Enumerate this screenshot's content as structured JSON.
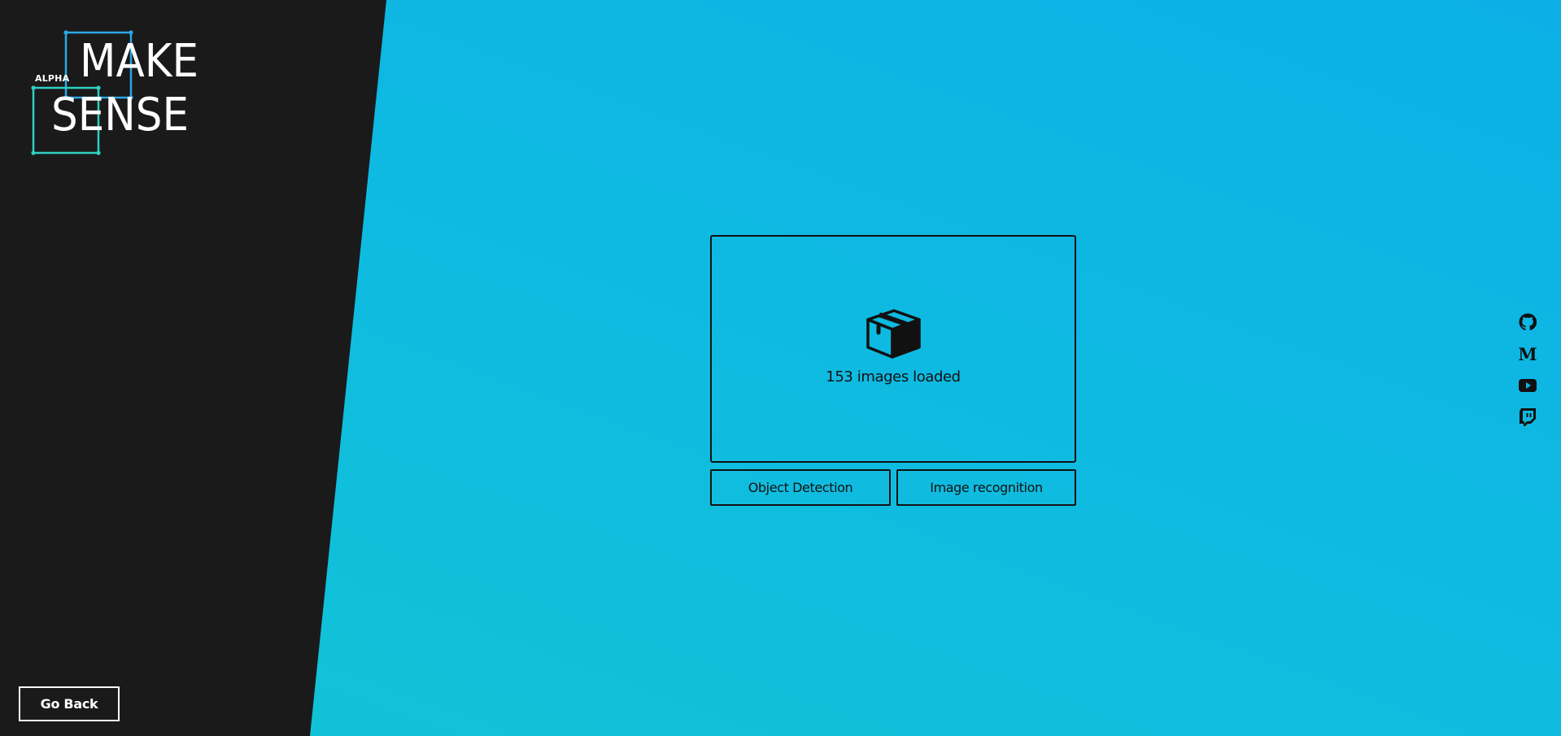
{
  "app": {
    "brand_top": "MAKE",
    "brand_bottom": "SENSE",
    "brand_tag": "ALPHA"
  },
  "dropzone": {
    "icon": "box-icon",
    "status_text": "153 images loaded"
  },
  "actions": {
    "object_detection_label": "Object Detection",
    "image_recognition_label": "Image recognition"
  },
  "navigation": {
    "go_back_label": "Go Back"
  },
  "social_links": [
    {
      "name": "github-icon"
    },
    {
      "name": "medium-icon"
    },
    {
      "name": "youtube-icon"
    },
    {
      "name": "twitch-icon"
    }
  ],
  "colors": {
    "panel_dark": "#1a1a1a",
    "background_gradient_start": "#0cb0e6",
    "background_gradient_end": "#12c4d4",
    "logo_blue": "#2aa8e6",
    "logo_teal": "#2fd0c0",
    "text_dark": "#111111",
    "text_light": "#ffffff"
  }
}
